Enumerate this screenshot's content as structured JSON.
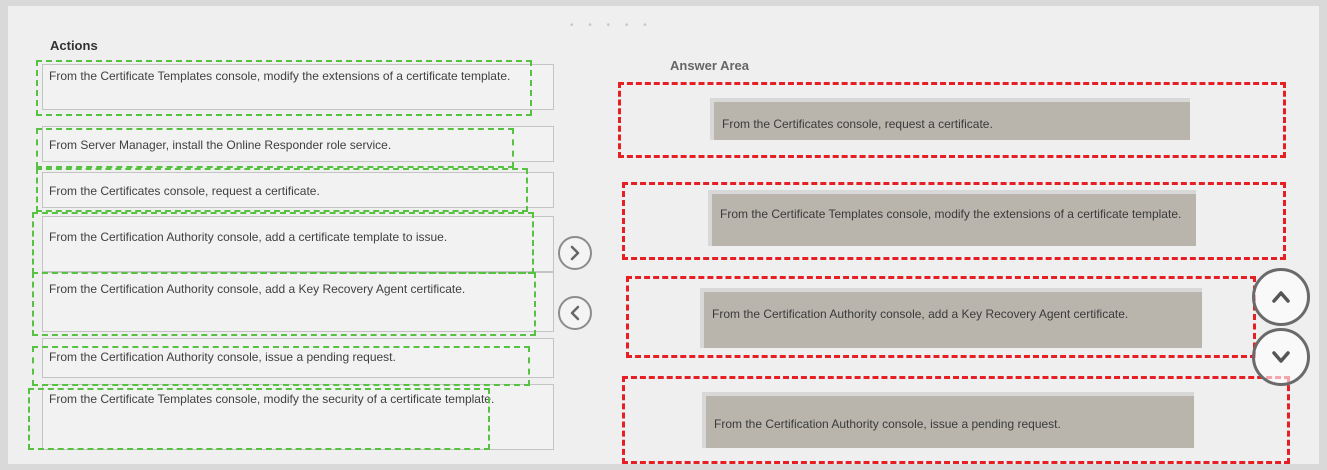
{
  "actions": {
    "title": "Actions",
    "items": [
      "From the Certificate Templates console, modify the extensions of a certificate template.",
      "From Server Manager, install the Online Responder role service.",
      "From the Certificates console, request a certificate.",
      "From the Certification Authority console, add a certificate template to issue.",
      "From the Certification Authority console, add a Key Recovery Agent certificate.",
      "From the Certification Authority console, issue a pending request.",
      "From the Certificate Templates console, modify the security of a certificate template."
    ]
  },
  "answer_area": {
    "title": "Answer Area",
    "items": [
      "From the Certificates console, request a certificate.",
      "From the Certificate Templates console, modify the extensions of a certificate template.",
      "From the Certification Authority console, add a Key Recovery Agent certificate.",
      "From the Certification Authority console, issue a pending request."
    ]
  },
  "icons": {
    "move_right": "chevron-right-icon",
    "move_left": "chevron-left-icon",
    "move_up": "chevron-up-icon",
    "move_down": "chevron-down-icon"
  },
  "colors": {
    "actions_dashed": "#57c241",
    "answer_dashed": "#e61f25"
  }
}
